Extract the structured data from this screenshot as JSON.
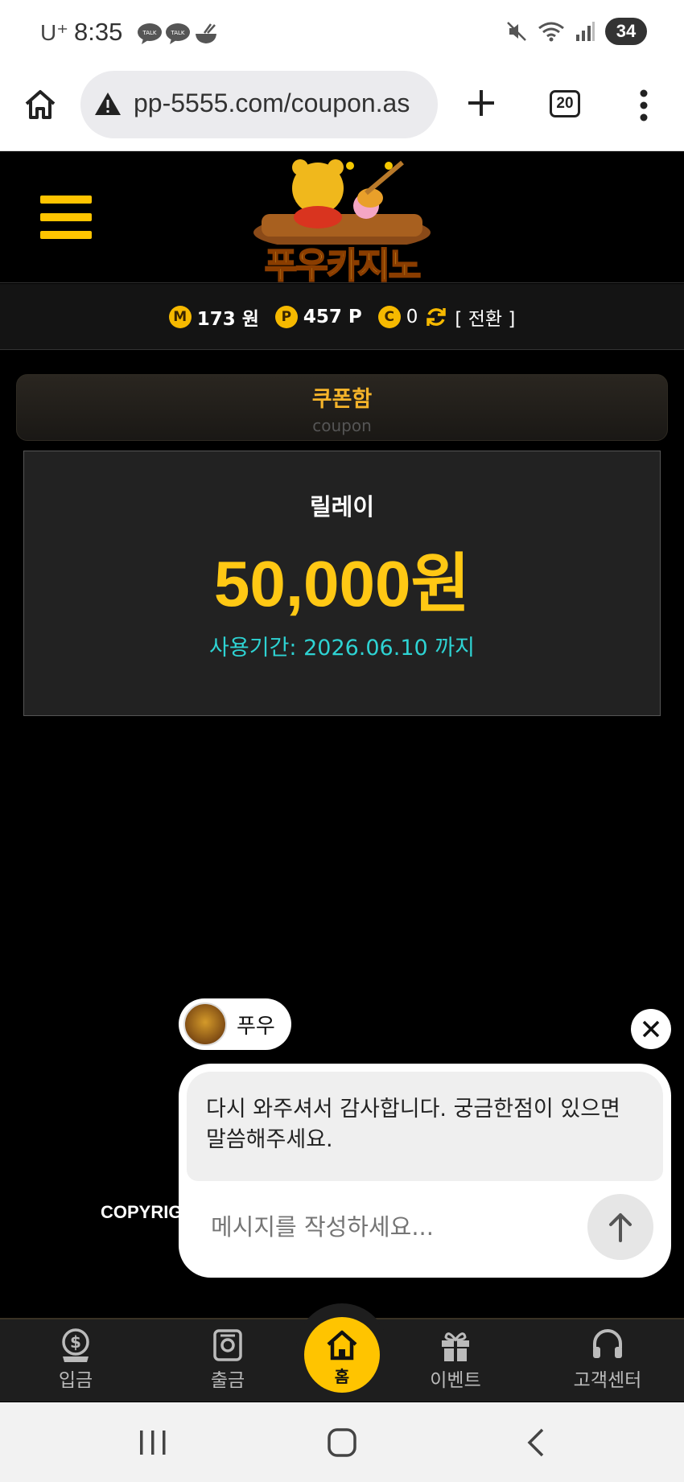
{
  "status_bar": {
    "carrier": "U⁺",
    "time": "8:35",
    "battery": "34"
  },
  "browser": {
    "url": "pp-5555.com/coupon.as",
    "tab_count": "20"
  },
  "site": {
    "logo_text": "푸우카지노"
  },
  "balance": {
    "money_icon": "M",
    "money_value": "173 원",
    "point_icon": "P",
    "point_value": "457 P",
    "coin_icon": "C",
    "coin_value": "0",
    "switch_label": "[ 전환 ]"
  },
  "coupon_section": {
    "title": "쿠폰함",
    "subtitle": "coupon"
  },
  "coupon": {
    "name": "릴레이",
    "amount": "50,000원",
    "expiry": "사용기간: 2026.06.10 까지"
  },
  "footer": {
    "copyright": "COPYRIG"
  },
  "chat": {
    "sender_name": "푸우",
    "message_line1": "다시 와주셔서 감사합니다. 궁금한점이 있으면",
    "message_line2": "말씀해주세요.",
    "input_placeholder": "메시지를 작성하세요..."
  },
  "bottom_nav": {
    "deposit": "입금",
    "withdraw": "출금",
    "home": "홈",
    "event": "이벤트",
    "support": "고객센터"
  },
  "colors": {
    "accent": "#ffc400",
    "coupon_amount": "#ffc814",
    "expiry_text": "#2ed3d3",
    "coupon_title": "#f5b42a"
  }
}
